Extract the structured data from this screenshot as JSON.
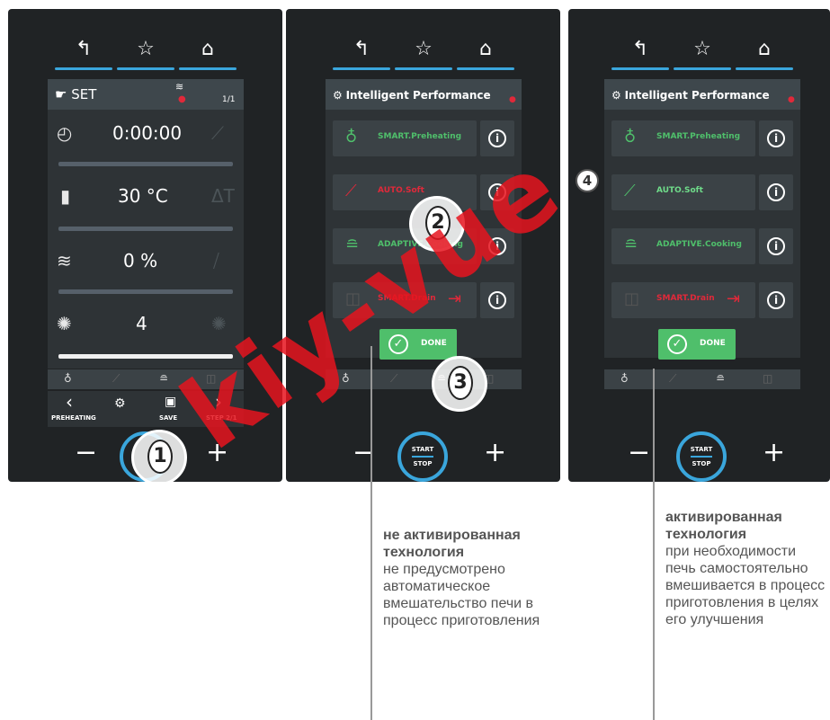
{
  "panel1": {
    "header": {
      "set_label": "SET",
      "step_count": "1/1"
    },
    "rows": [
      {
        "value": "0:00:00",
        "side": "probe"
      },
      {
        "value": "30 °C",
        "side": "ΔT"
      },
      {
        "value": "0 %",
        "side": "vent"
      },
      {
        "value": "4",
        "side": "fan"
      }
    ],
    "bottom": {
      "prev_label": "PREHEATING",
      "save_label": "SAVE",
      "next_label": "STEP 2/1"
    }
  },
  "ip_title": "Intelligent Performance",
  "panel2": {
    "items": [
      {
        "label": "SMART.Preheating",
        "state": "green"
      },
      {
        "label": "AUTO.Soft",
        "state": "red"
      },
      {
        "label": "ADAPTIVE.Cooking",
        "state": "green"
      },
      {
        "label": "SMART.Drain",
        "state": "red"
      }
    ],
    "done_label": "DONE"
  },
  "panel3": {
    "items": [
      {
        "label": "SMART.Preheating",
        "state": "green"
      },
      {
        "label": "AUTO.Soft",
        "state": "green"
      },
      {
        "label": "ADAPTIVE.Cooking",
        "state": "green"
      },
      {
        "label": "SMART.Drain",
        "state": "red"
      }
    ],
    "done_label": "DONE"
  },
  "start_label": "START",
  "stop_label": "STOP",
  "steps": [
    "1",
    "2",
    "3",
    "4"
  ],
  "annotations": {
    "left": {
      "title": "не активированная технология",
      "body": "не предусмотрено автоматическое вмешательство печи в процесс приготовления"
    },
    "right": {
      "title": "активированная технология",
      "body": "при необходимости печь самостоятельно вмешивается в процесс приготовления в целях его улучшения"
    }
  },
  "watermark": "kiy-vue",
  "colors": {
    "accent": "#3aa6dc",
    "active": "#4fbf6b",
    "inactive": "#e0293a",
    "panel": "#202325"
  }
}
